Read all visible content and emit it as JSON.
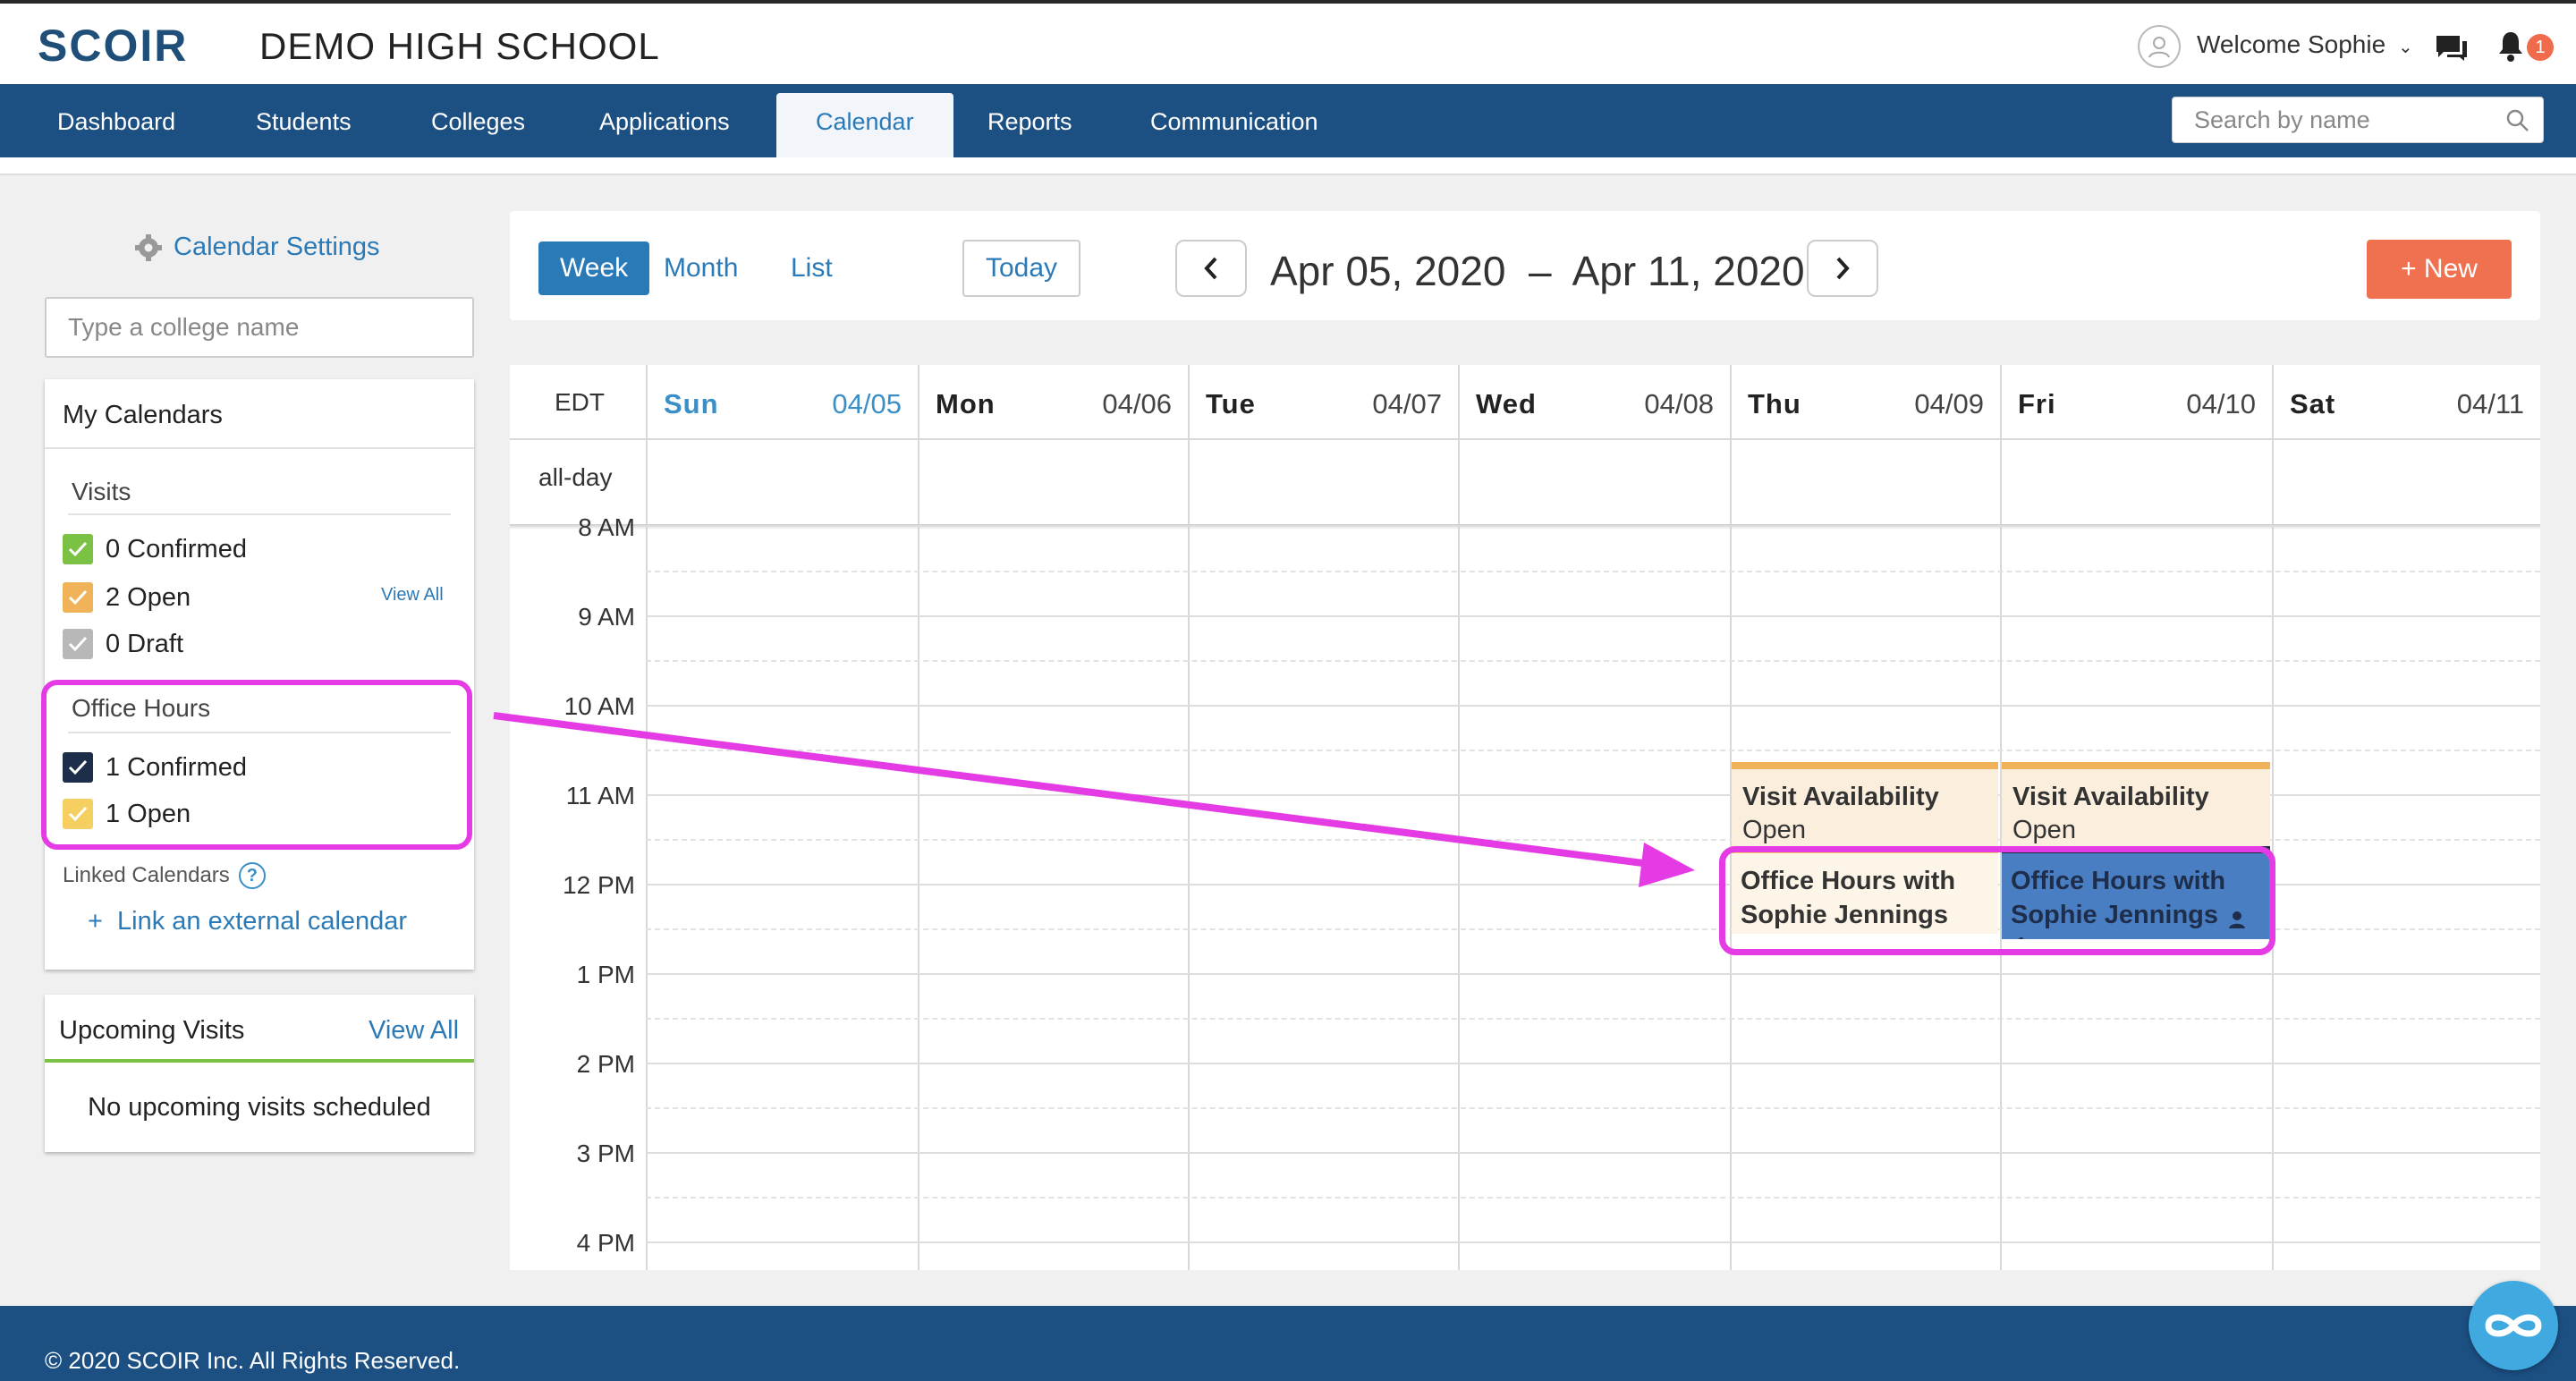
{
  "header": {
    "logo": "SCOIR",
    "school": "DEMO HIGH SCHOOL",
    "welcome": "Welcome Sophie",
    "notifications": "1"
  },
  "nav": {
    "items": [
      "Dashboard",
      "Students",
      "Colleges",
      "Applications",
      "Calendar",
      "Reports",
      "Communication"
    ],
    "active": "Calendar",
    "search_placeholder": "Search by name"
  },
  "sidebar": {
    "settings_label": "Calendar Settings",
    "college_placeholder": "Type a college name",
    "my_calendars_title": "My Calendars",
    "visits": {
      "title": "Visits",
      "items": [
        {
          "label": "0 Confirmed",
          "color": "#7bc144"
        },
        {
          "label": "2 Open",
          "color": "#f0b35a"
        },
        {
          "label": "0 Draft",
          "color": "#b8b8b8"
        }
      ],
      "view_all": "View All"
    },
    "office_hours": {
      "title": "Office Hours",
      "items": [
        {
          "label": "1 Confirmed",
          "color": "#1c2e4a"
        },
        {
          "label": "1 Open",
          "color": "#f5d061"
        }
      ]
    },
    "linked_title": "Linked Calendars",
    "link_external": "+  Link an external calendar",
    "upcoming": {
      "title": "Upcoming Visits",
      "view_all": "View All",
      "empty": "No upcoming visits scheduled"
    }
  },
  "toolbar": {
    "views": [
      "Week",
      "Month",
      "List"
    ],
    "active_view": "Week",
    "today": "Today",
    "range": "Apr 05, 2020  –  Apr 11, 2020",
    "new": "+ New"
  },
  "calendar": {
    "timezone": "EDT",
    "allday": "all-day",
    "days": [
      {
        "name": "Sun",
        "date": "04/05",
        "today": true
      },
      {
        "name": "Mon",
        "date": "04/06"
      },
      {
        "name": "Tue",
        "date": "04/07"
      },
      {
        "name": "Wed",
        "date": "04/08"
      },
      {
        "name": "Thu",
        "date": "04/09"
      },
      {
        "name": "Fri",
        "date": "04/10"
      },
      {
        "name": "Sat",
        "date": "04/11"
      }
    ],
    "hours": [
      "8 AM",
      "9 AM",
      "10 AM",
      "11 AM",
      "12 PM",
      "1 PM",
      "2 PM",
      "3 PM",
      "4 PM"
    ],
    "events": [
      {
        "title": "Visit Availability",
        "sub": "Open",
        "kind": "visit-open"
      },
      {
        "title": "Visit Availability",
        "sub": "Open",
        "kind": "visit-open"
      },
      {
        "title": "Office Hours with Sophie Jennings",
        "sub": "",
        "kind": "office-open"
      },
      {
        "title": "Office Hours with Sophie Jennings",
        "sub": "",
        "attendees": "1",
        "kind": "office-confirmed"
      }
    ],
    "colors": {
      "visit_open_bg": "#fbeedd",
      "visit_open_bar": "#f0b35a",
      "office_open_bg": "#fdf5e7",
      "office_open_bar": "#f5d061",
      "office_confirmed_bg": "#4a7ec3",
      "office_confirmed_bar": "#1c2e4a"
    }
  },
  "footer": {
    "copyright": "© 2020 SCOIR Inc. All Rights Reserved."
  },
  "annotation": {
    "highlight_color": "#e53be5"
  }
}
